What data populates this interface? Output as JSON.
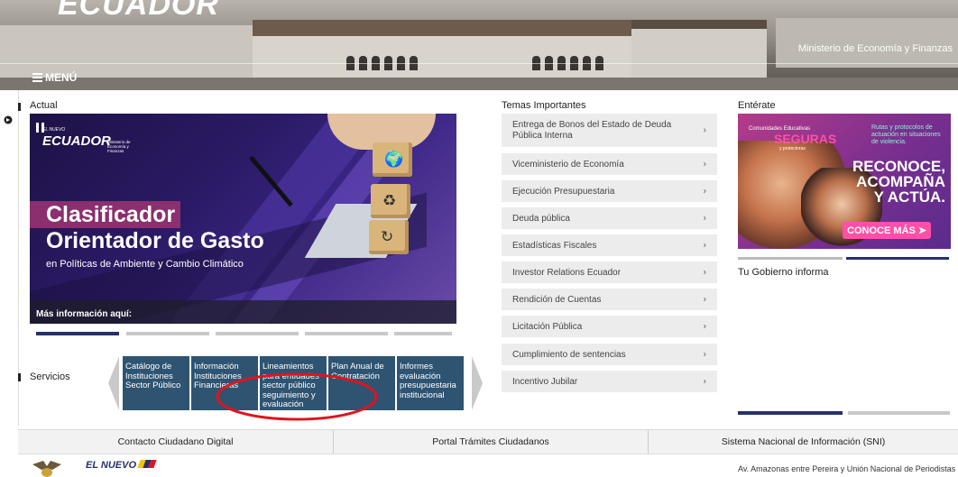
{
  "header": {
    "logo_text": "ECUADOR",
    "ministry": "Ministerio de Economía y Finanzas",
    "menu_label": "MENÚ"
  },
  "sections": {
    "actual": "Actual",
    "temas": "Temas Importantes",
    "enterate": "Entérate",
    "servicios": "Servicios",
    "gobierno": "Tu Gobierno informa"
  },
  "carousel": {
    "logo_prefix": "EL NUEVO",
    "logo": "ECUADOR",
    "logo_ministry": "Ministerio de Economía y Finanzas",
    "title_line1": "Clasificador",
    "title_line2": "Orientador de Gasto",
    "subtitle": "en Políticas de Ambiente y Cambio Climático",
    "more": "Más información aquí:"
  },
  "services": [
    "Catálogo de Instituciones Sector Público",
    "Información Instituciones Financieras",
    "Lineamientos para entidades sector público seguimiento y evaluación",
    "Plan Anual de Contratación",
    "Informes evaluación presupuestaria institucional"
  ],
  "temas": [
    "Entrega de Bonos del Estado de Deuda Pública Interna",
    "Viceministerio de Economía",
    "Ejecución Presupuestaria",
    "Deuda pública",
    "Estadísticas Fiscales",
    "Investor Relations Ecuador",
    "Rendición de Cuentas",
    "Licitación Pública",
    "Cumplimiento de sentencias",
    "Incentivo Jubilar"
  ],
  "promo": {
    "tag1": "Comunidades Educativas",
    "tag2": "SEGURAS",
    "tag3": "y protectoras",
    "right_text": "Rutas y protocolos de actuación en situaciones de violencia.",
    "big": "RECONOCE, ACOMPAÑA Y ACTÚA.",
    "button": "CONOCE MÁS"
  },
  "footer": {
    "links": [
      "Contacto Ciudadano Digital",
      "Portal Trámites Ciudadanos",
      "Sistema Nacional de Información (SNI)"
    ],
    "logo": "EL NUEVO",
    "address": "Av. Amazonas entre Pereira y Unión Nacional de Periodistas"
  },
  "colors": {
    "nav_blue": "#27306b",
    "service_tile": "#2e5472",
    "annotation_red": "#e0141d",
    "accent_pink": "#ff4fa8"
  }
}
